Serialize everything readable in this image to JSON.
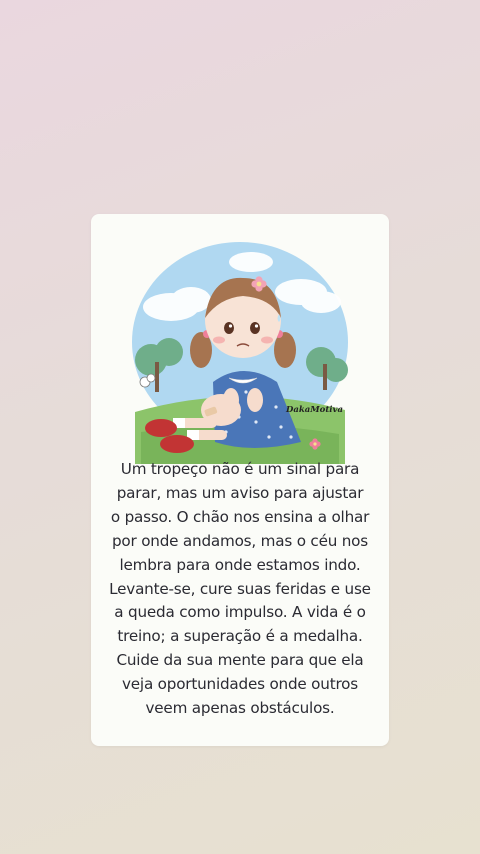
{
  "illustration": {
    "description_icon": "girl-with-scraped-knee-illustration",
    "signature": "DakaMotiva"
  },
  "quote": {
    "lines": [
      "Um tropeço não é um sinal para",
      "parar, mas um aviso para ajustar",
      "o passo. O chão nos ensina a olhar",
      "por onde andamos, mas o céu nos",
      "lembra para onde estamos indo.",
      "Levante-se, cure suas feridas e use",
      "a queda como impulso. A vida é o",
      "treino; a superação é a medalha.",
      "Cuide da sua mente para que ela",
      "veja oportunidades onde outros",
      "veem apenas obstáculos."
    ]
  },
  "colors": {
    "card": "#fbfcf8",
    "text": "#2b2b33",
    "dress": "#4a76b8",
    "shoes": "#c23434",
    "sky": "#9fd0ee",
    "grass": "#8cc46a"
  }
}
